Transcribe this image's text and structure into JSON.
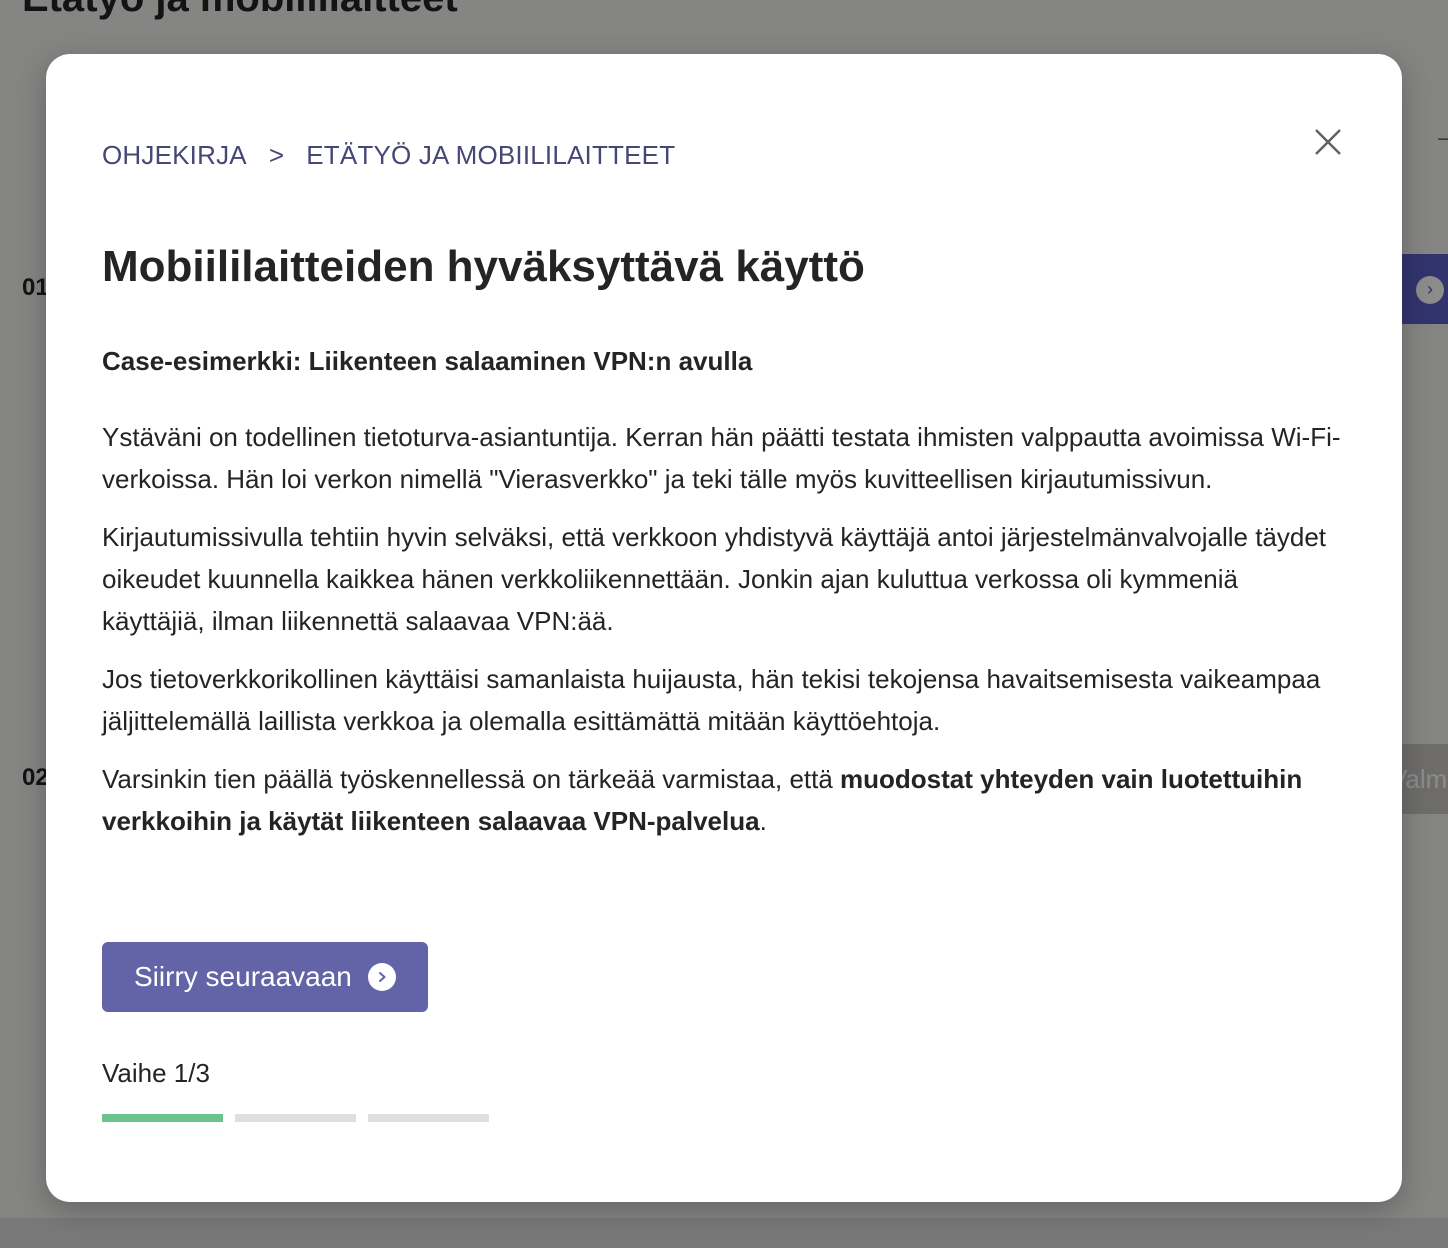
{
  "background": {
    "page_title": "Etätyö ja mobiililaitteet",
    "step_numbers": [
      "01",
      "02"
    ],
    "done_button_label": "Valmis"
  },
  "modal": {
    "breadcrumb": [
      "OHJEKIRJA",
      "ETÄTYÖ JA MOBIILILAITTEET"
    ],
    "breadcrumb_separator": ">",
    "title": "Mobiililaitteiden hyväksyttävä käyttö",
    "subtitle": "Case-esimerkki: Liikenteen salaaminen VPN:n avulla",
    "paragraphs": [
      "Ystäväni on todellinen tietoturva-asiantuntija. Kerran hän päätti testata ihmisten valppautta avoimissa Wi-Fi-verkoissa. Hän loi verkon nimellä \"Vierasverkko\" ja teki tälle myös kuvitteellisen kirjautumissivun.",
      "Kirjautumissivulla tehtiin hyvin selväksi, että verkkoon yhdistyvä käyttäjä antoi järjestelmänvalvojalle täydet oikeudet kuunnella kaikkea hänen verkkoliikennettään. Jonkin ajan kuluttua verkossa oli kymmeniä käyttäjiä, ilman liikennettä salaavaa VPN:ää.",
      "Jos tietoverkkorikollinen käyttäisi samanlaista huijausta, hän tekisi tekojensa havaitsemisesta vaikeampaa jäljittelemällä laillista verkkoa ja olemalla esittämättä mitään käyttöehtoja."
    ],
    "last_paragraph": {
      "lead": "Varsinkin tien päällä työskennellessä on tärkeää varmistaa, että ",
      "bold": "muodostat yhteyden vain luotettuihin verkkoihin ja käytät liikenteen salaavaa VPN-palvelua",
      "tail": "."
    },
    "next_button": "Siirry seuraavaan",
    "step_label": "Vaihe 1/3",
    "progress": {
      "current": 1,
      "total": 3
    }
  },
  "colors": {
    "accent": "#6264a7",
    "breadcrumb": "#464775",
    "progress_done": "#6ac38c",
    "progress_todo": "#e1dfdd"
  },
  "icons": {
    "close": "close-icon",
    "next": "chevron-right-circle-icon"
  }
}
